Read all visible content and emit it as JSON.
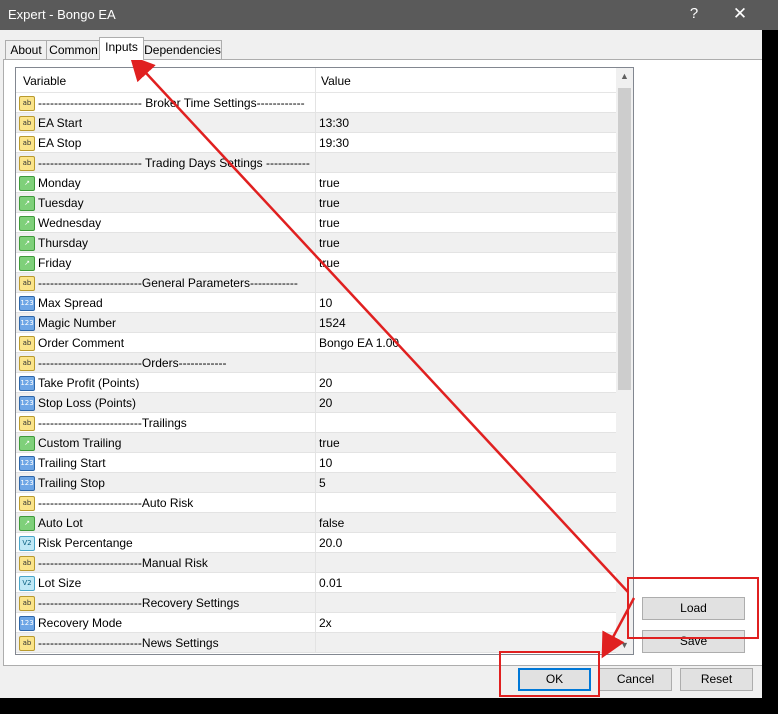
{
  "window": {
    "title": "Expert - Bongo EA",
    "help_label": "?",
    "close_label": "✕"
  },
  "tabs": [
    {
      "label": "About"
    },
    {
      "label": "Common"
    },
    {
      "label": "Inputs"
    },
    {
      "label": "Dependencies"
    }
  ],
  "grid": {
    "headers": {
      "variable": "Variable",
      "value": "Value"
    },
    "rows": [
      {
        "icon": "string-icon",
        "icon_text": "ab",
        "name": "-------------------------- Broker Time Settings------------",
        "value": ""
      },
      {
        "icon": "string-icon",
        "icon_text": "ab",
        "name": "EA Start",
        "value": "13:30"
      },
      {
        "icon": "string-icon",
        "icon_text": "ab",
        "name": "EA Stop",
        "value": "19:30"
      },
      {
        "icon": "string-icon",
        "icon_text": "ab",
        "name": "-------------------------- Trading Days Settings -----------",
        "value": ""
      },
      {
        "icon": "bool-icon",
        "icon_text": "↗",
        "name": "Monday",
        "value": "true"
      },
      {
        "icon": "bool-icon",
        "icon_text": "↗",
        "name": "Tuesday",
        "value": "true"
      },
      {
        "icon": "bool-icon",
        "icon_text": "↗",
        "name": "Wednesday",
        "value": "true"
      },
      {
        "icon": "bool-icon",
        "icon_text": "↗",
        "name": "Thursday",
        "value": "true"
      },
      {
        "icon": "bool-icon",
        "icon_text": "↗",
        "name": "Friday",
        "value": "true"
      },
      {
        "icon": "string-icon",
        "icon_text": "ab",
        "name": "--------------------------General Parameters------------",
        "value": ""
      },
      {
        "icon": "int-icon",
        "icon_text": "123",
        "name": "Max Spread",
        "value": "10"
      },
      {
        "icon": "int-icon",
        "icon_text": "123",
        "name": "Magic Number",
        "value": "1524"
      },
      {
        "icon": "string-icon",
        "icon_text": "ab",
        "name": "Order Comment",
        "value": "Bongo EA 1.00"
      },
      {
        "icon": "string-icon",
        "icon_text": "ab",
        "name": "--------------------------Orders------------",
        "value": ""
      },
      {
        "icon": "int-icon",
        "icon_text": "123",
        "name": "Take Profit (Points)",
        "value": "20"
      },
      {
        "icon": "int-icon",
        "icon_text": "123",
        "name": "Stop Loss (Points)",
        "value": "20"
      },
      {
        "icon": "string-icon",
        "icon_text": "ab",
        "name": "--------------------------Trailings",
        "value": ""
      },
      {
        "icon": "bool-icon",
        "icon_text": "↗",
        "name": "Custom Trailing",
        "value": "true"
      },
      {
        "icon": "int-icon",
        "icon_text": "123",
        "name": "Trailing Start",
        "value": "10"
      },
      {
        "icon": "int-icon",
        "icon_text": "123",
        "name": "Trailing Stop",
        "value": "5"
      },
      {
        "icon": "string-icon",
        "icon_text": "ab",
        "name": "--------------------------Auto Risk",
        "value": ""
      },
      {
        "icon": "bool-icon",
        "icon_text": "↗",
        "name": "Auto Lot",
        "value": "false"
      },
      {
        "icon": "double-icon",
        "icon_text": "V2",
        "name": "Risk Percentange",
        "value": "20.0"
      },
      {
        "icon": "string-icon",
        "icon_text": "ab",
        "name": "--------------------------Manual Risk",
        "value": ""
      },
      {
        "icon": "double-icon",
        "icon_text": "V2",
        "name": "Lot Size",
        "value": "0.01"
      },
      {
        "icon": "string-icon",
        "icon_text": "ab",
        "name": "--------------------------Recovery Settings",
        "value": ""
      },
      {
        "icon": "int-icon",
        "icon_text": "123",
        "name": "Recovery Mode",
        "value": "2x"
      },
      {
        "icon": "string-icon",
        "icon_text": "ab",
        "name": "--------------------------News Settings",
        "value": ""
      }
    ]
  },
  "buttons": {
    "load": "Load",
    "save": "Save",
    "ok": "OK",
    "cancel": "Cancel",
    "reset": "Reset"
  },
  "annotation_color": "#e02020"
}
